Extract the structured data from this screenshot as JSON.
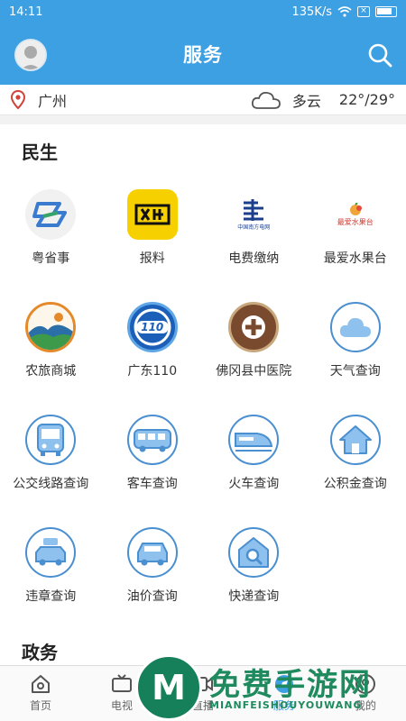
{
  "status_bar": {
    "time": "14:11",
    "network_speed": "135K/s"
  },
  "header": {
    "title": "服务"
  },
  "weather": {
    "city": "广州",
    "condition": "多云",
    "temperature": "22°/29°"
  },
  "sections": [
    {
      "title": "民生",
      "items": [
        {
          "label": "粤省事",
          "icon": "yueshengshi-logo"
        },
        {
          "label": "报料",
          "icon": "baoliao-logo"
        },
        {
          "label": "电费缴纳",
          "icon": "china-southern-grid-logo",
          "logo_text": "中国南方电网"
        },
        {
          "label": "最爱水果台",
          "icon": "fruit-logo",
          "logo_text": "最爱水果台"
        },
        {
          "label": "农旅商城",
          "icon": "farm-mall-logo"
        },
        {
          "label": "广东110",
          "icon": "police-110-logo",
          "logo_text": "110"
        },
        {
          "label": "佛冈县中医院",
          "icon": "hospital-logo"
        },
        {
          "label": "天气查询",
          "icon": "cloud-icon"
        },
        {
          "label": "公交线路查询",
          "icon": "bus-icon"
        },
        {
          "label": "客车查询",
          "icon": "coach-icon"
        },
        {
          "label": "火车查询",
          "icon": "train-icon"
        },
        {
          "label": "公积金查询",
          "icon": "house-icon"
        },
        {
          "label": "违章查询",
          "icon": "car-violation-icon"
        },
        {
          "label": "油价查询",
          "icon": "car-icon"
        },
        {
          "label": "快递查询",
          "icon": "parcel-search-icon"
        }
      ]
    },
    {
      "title": "政务"
    }
  ],
  "tabs": [
    {
      "label": "首页",
      "icon": "home-icon",
      "active": false
    },
    {
      "label": "电视",
      "icon": "tv-icon",
      "active": false
    },
    {
      "label": "直播",
      "icon": "live-icon",
      "active": false
    },
    {
      "label": "服务",
      "icon": "service-icon",
      "active": true
    },
    {
      "label": "我的",
      "icon": "profile-icon",
      "active": false
    }
  ],
  "watermark": {
    "text": "免费手游网",
    "subtext": "MIANFEISHOUYOUWANG"
  },
  "colors": {
    "primary": "#3da0e3",
    "icon_blue": "#4a8fd0",
    "watermark_green": "#1f8a5e"
  }
}
